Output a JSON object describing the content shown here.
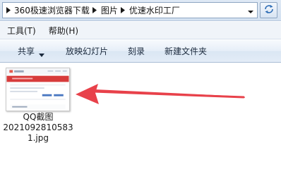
{
  "address_bar": {
    "breadcrumbs": [
      "360极速浏览器下载",
      "图片",
      "优速水印工厂"
    ]
  },
  "menu": {
    "items": [
      "工具(T)",
      "帮助(H)"
    ]
  },
  "command_bar": {
    "share_label": "共享",
    "slideshow_label": "放映幻灯片",
    "burn_label": "刻录",
    "new_folder_label": "新建文件夹"
  },
  "files": [
    {
      "name_lines": [
        "QQ截图",
        "2021092810583",
        "1.jpg"
      ]
    }
  ],
  "colors": {
    "arrow": "#e8414a",
    "command_text": "#1b2a3d",
    "window_frame": "#d3e1f1"
  },
  "icons": {
    "refresh": "refresh-icon",
    "dropdown": "chevron-down-icon",
    "crumb_separator": "breadcrumb-arrow-icon"
  }
}
